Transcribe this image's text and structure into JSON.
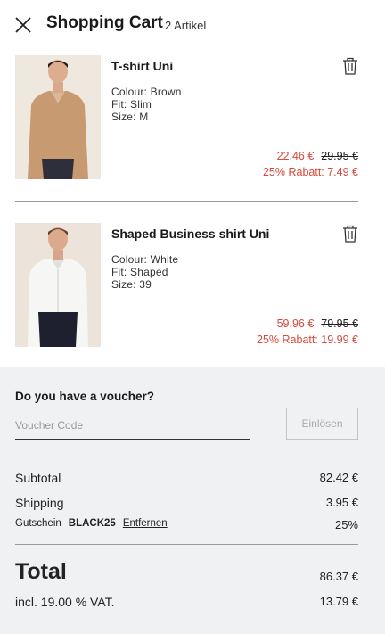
{
  "header": {
    "title": "Shopping Cart",
    "count": "2 Artikel"
  },
  "items": [
    {
      "name": "T-shirt Uni",
      "colour": "Colour: Brown",
      "fit": "Fit: Slim",
      "size": "Size: M",
      "price": "22.46 €",
      "old_price": "29.95 €",
      "discount": "25% Rabatt: 7.49 €"
    },
    {
      "name": "Shaped Business shirt Uni",
      "colour": "Colour: White",
      "fit": "Fit: Shaped",
      "size": "Size: 39",
      "price": "59.96 €",
      "old_price": "79.95 €",
      "discount": "25% Rabatt: 19.99 €"
    }
  ],
  "voucher": {
    "question": "Do you have a voucher?",
    "placeholder": "Voucher Code",
    "button": "Einlösen"
  },
  "summary": {
    "subtotal_label": "Subtotal",
    "subtotal_value": "82.42 €",
    "shipping_label": "Shipping",
    "shipping_value": "3.95 €",
    "voucher_label": "Gutschein",
    "voucher_code": "BLACK25",
    "voucher_remove": "Entfernen",
    "voucher_value": "25%",
    "total_label": "Total",
    "total_value": "86.37 €",
    "vat_label": "incl. 19.00 % VAT.",
    "vat_value": "13.79 €"
  },
  "colors": {
    "discount": "#d9473b",
    "panel_bg": "#f0f1f3"
  },
  "icons": [
    "close-icon",
    "trash-icon"
  ]
}
